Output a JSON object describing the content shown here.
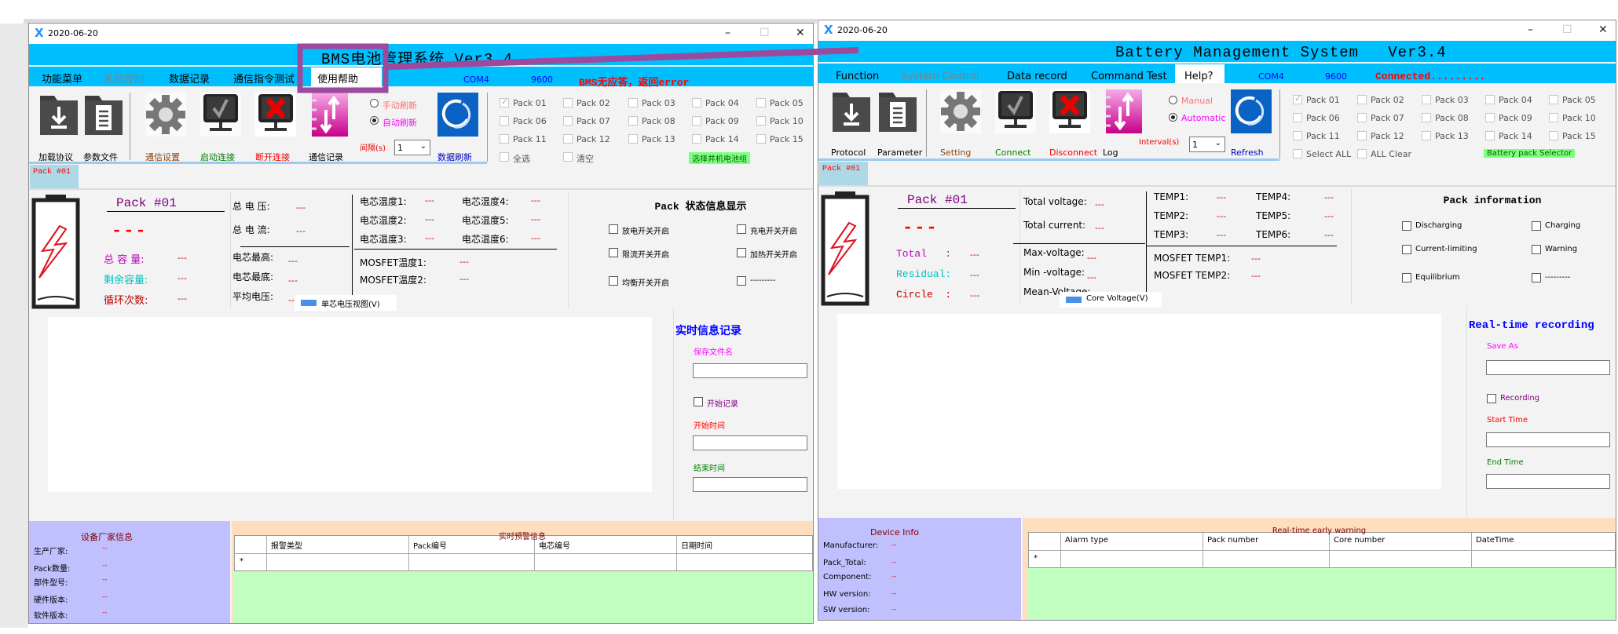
{
  "windows": [
    {
      "lang": "zh",
      "title_date": "2020-06-20",
      "header_title": "BMS电池管理系统 Ver3.4",
      "menu": [
        {
          "label": "功能菜单",
          "color": "#000000"
        },
        {
          "label": "系统控制",
          "color": "#808080"
        },
        {
          "label": "数据记录",
          "color": "#000000"
        },
        {
          "label": "通信指令测试",
          "color": "#000000"
        },
        {
          "label": "使用帮助",
          "color": "#000000"
        }
      ],
      "com_port": "COM4",
      "baud": "9600",
      "status": "BMS无应答，返回error",
      "toolbar": {
        "protocol": "加载协议",
        "parameter": "参数文件",
        "setting": "通信设置",
        "connect": "启动连接",
        "disconnect": "断开连接",
        "log": "通信记录",
        "manual": "手动刷新",
        "automatic": "自动刷新",
        "automatic_selected": true,
        "interval_label": "间隔(s)",
        "interval_value": "1",
        "refresh": "数据刷新"
      },
      "packs": [
        "Pack 01",
        "Pack 02",
        "Pack 03",
        "Pack 04",
        "Pack 05",
        "Pack 06",
        "Pack 07",
        "Pack 08",
        "Pack 09",
        "Pack 10",
        "Pack 11",
        "Pack 12",
        "Pack 13",
        "Pack 14",
        "Pack 15"
      ],
      "packs_checked": [
        "Pack 01"
      ],
      "select_all": "全选",
      "all_clear": "清空",
      "selector_label": "选择并机电池组",
      "tab": "Pack #01",
      "info": {
        "pack_title": "Pack #01",
        "pack_value": "---",
        "capacity": [
          {
            "label": "总 容 量:",
            "value": "---",
            "color": "#c000c0"
          },
          {
            "label": "剩余容量:",
            "value": "---",
            "color": "#00c0c0"
          },
          {
            "label": "循环次数:",
            "value": "---",
            "color": "#c00000"
          }
        ],
        "voltage": [
          {
            "label": "总 电 压:",
            "value": "---"
          },
          {
            "label": "总 电 流:",
            "value": "---"
          }
        ],
        "cells": [
          {
            "label": "电芯最高:",
            "value": "---"
          },
          {
            "label": "电芯最底:",
            "value": "---"
          },
          {
            "label": "平均电压:",
            "value": "---"
          }
        ],
        "temps": [
          {
            "label": "电芯温度1:",
            "value": "---"
          },
          {
            "label": "电芯温度2:",
            "value": "---"
          },
          {
            "label": "电芯温度3:",
            "value": "---"
          },
          {
            "label": "电芯温度4:",
            "value": "---"
          },
          {
            "label": "电芯温度5:",
            "value": "---"
          },
          {
            "label": "电芯温度6:",
            "value": "---"
          }
        ],
        "mosfet": [
          {
            "label": "MOSFET温度1:",
            "value": "---"
          },
          {
            "label": "MOSFET温度2:",
            "value": "---"
          }
        ],
        "status_title": "Pack 状态信息显示",
        "status_flags": [
          "放电开关开启",
          "充电开关开启",
          "限流开关开启",
          "加热开关开启",
          "均衡开关开启",
          "---------"
        ]
      },
      "chart_legend": "单芯电压视图(V)",
      "recording": {
        "title": "实时信息记录",
        "save_as": "保存文件名",
        "save_as_value": "",
        "record_checkbox": "开始记录",
        "start_time": "开始时间",
        "start_time_value": "",
        "end_time": "结束时间",
        "end_time_value": ""
      },
      "device_info": {
        "title": "设备厂家信息",
        "rows": [
          {
            "label": "生产厂家:",
            "value": "--"
          },
          {
            "label": "Pack数量:",
            "value": "--"
          },
          {
            "label": "部件型号:",
            "value": "--"
          },
          {
            "label": "硬件版本:",
            "value": "--"
          },
          {
            "label": "软件版本:",
            "value": "--"
          }
        ]
      },
      "alarm": {
        "title": "实时预警信息",
        "columns": [
          "报警类型",
          "Pack编号",
          "电芯编号",
          "日期时间"
        ],
        "new_row_marker": "*"
      }
    },
    {
      "lang": "en",
      "title_date": "2020-06-20",
      "header_title": "Battery Management System   Ver3.4",
      "menu": [
        {
          "label": "Function",
          "color": "#000000"
        },
        {
          "label": "System Control",
          "color": "#808080"
        },
        {
          "label": "Data record",
          "color": "#000000"
        },
        {
          "label": "Command Test",
          "color": "#000000"
        },
        {
          "label": "Help?",
          "color": "#000000"
        }
      ],
      "com_port": "COM4",
      "baud": "9600",
      "status": "Connected.........",
      "toolbar": {
        "protocol": "Protocol",
        "parameter": "Parameter",
        "setting": "Setting",
        "connect": "Connect",
        "disconnect": "Disconnect",
        "log": "Log",
        "manual": "Manual",
        "automatic": "Automatic",
        "automatic_selected": true,
        "interval_label": "Interval(s)",
        "interval_value": "1",
        "refresh": "Refresh"
      },
      "packs": [
        "Pack 01",
        "Pack 02",
        "Pack 03",
        "Pack 04",
        "Pack 05",
        "Pack 06",
        "Pack 07",
        "Pack 08",
        "Pack 09",
        "Pack 10",
        "Pack 11",
        "Pack 12",
        "Pack 13",
        "Pack 14",
        "Pack 15"
      ],
      "packs_checked": [
        "Pack 01"
      ],
      "select_all": "Select ALL",
      "all_clear": "ALL Clear",
      "selector_label": "Battery pack Selector",
      "tab": "Pack #01",
      "info": {
        "pack_title": "Pack #01",
        "pack_value": "---",
        "capacity": [
          {
            "label": "Total   :",
            "value": "---",
            "color": "#c000c0"
          },
          {
            "label": "Residual:",
            "value": "---",
            "color": "#00c0c0"
          },
          {
            "label": "Circle  :",
            "value": "---",
            "color": "#c00000"
          }
        ],
        "voltage": [
          {
            "label": "Total voltage:",
            "value": "---"
          },
          {
            "label": "Total current:",
            "value": "---"
          }
        ],
        "cells": [
          {
            "label": "Max-voltage:",
            "value": "---"
          },
          {
            "label": "Min -voltage:",
            "value": "---"
          },
          {
            "label": "Mean-Voltage:",
            "value": "---"
          }
        ],
        "temps": [
          {
            "label": "TEMP1:",
            "value": "---"
          },
          {
            "label": "TEMP2:",
            "value": "---"
          },
          {
            "label": "TEMP3:",
            "value": "---"
          },
          {
            "label": "TEMP4:",
            "value": "---"
          },
          {
            "label": "TEMP5:",
            "value": "---"
          },
          {
            "label": "TEMP6:",
            "value": "---"
          }
        ],
        "mosfet": [
          {
            "label": "MOSFET TEMP1:",
            "value": "---"
          },
          {
            "label": "MOSFET TEMP2:",
            "value": "---"
          }
        ],
        "status_title": "Pack information",
        "status_flags": [
          "Discharging",
          "Charging",
          "Current-limiting",
          "Warning",
          "Equilibrium",
          "---------"
        ]
      },
      "chart_legend": "Core Voltage(V)",
      "recording": {
        "title": "Real-time recording",
        "save_as": "Save As",
        "save_as_value": "",
        "record_checkbox": "Recording",
        "start_time": "Start Time",
        "start_time_value": "",
        "end_time": "End Time",
        "end_time_value": ""
      },
      "device_info": {
        "title": "Device Info",
        "rows": [
          {
            "label": "Manufacturer:",
            "value": "--"
          },
          {
            "label": "Pack_Total:",
            "value": "--"
          },
          {
            "label": "Component:",
            "value": "--"
          },
          {
            "label": "HW version:",
            "value": "--"
          },
          {
            "label": "SW version:",
            "value": "--"
          }
        ]
      },
      "alarm": {
        "title": "Real-time early warning",
        "columns": [
          "Alarm type",
          "Pack number",
          "Core number",
          "DateTime"
        ],
        "new_row_marker": "*"
      }
    }
  ],
  "colors": {
    "header_band": "#00bfff",
    "highlight": "#9b4a9e",
    "device_info_bg": "#c0c0ff",
    "alarm_bg": "#ffdec0",
    "alarm_area": "#c0ffc0",
    "selector_bg": "#80ff80",
    "status_text": "#ff0000",
    "com_text": "#0000ff"
  }
}
